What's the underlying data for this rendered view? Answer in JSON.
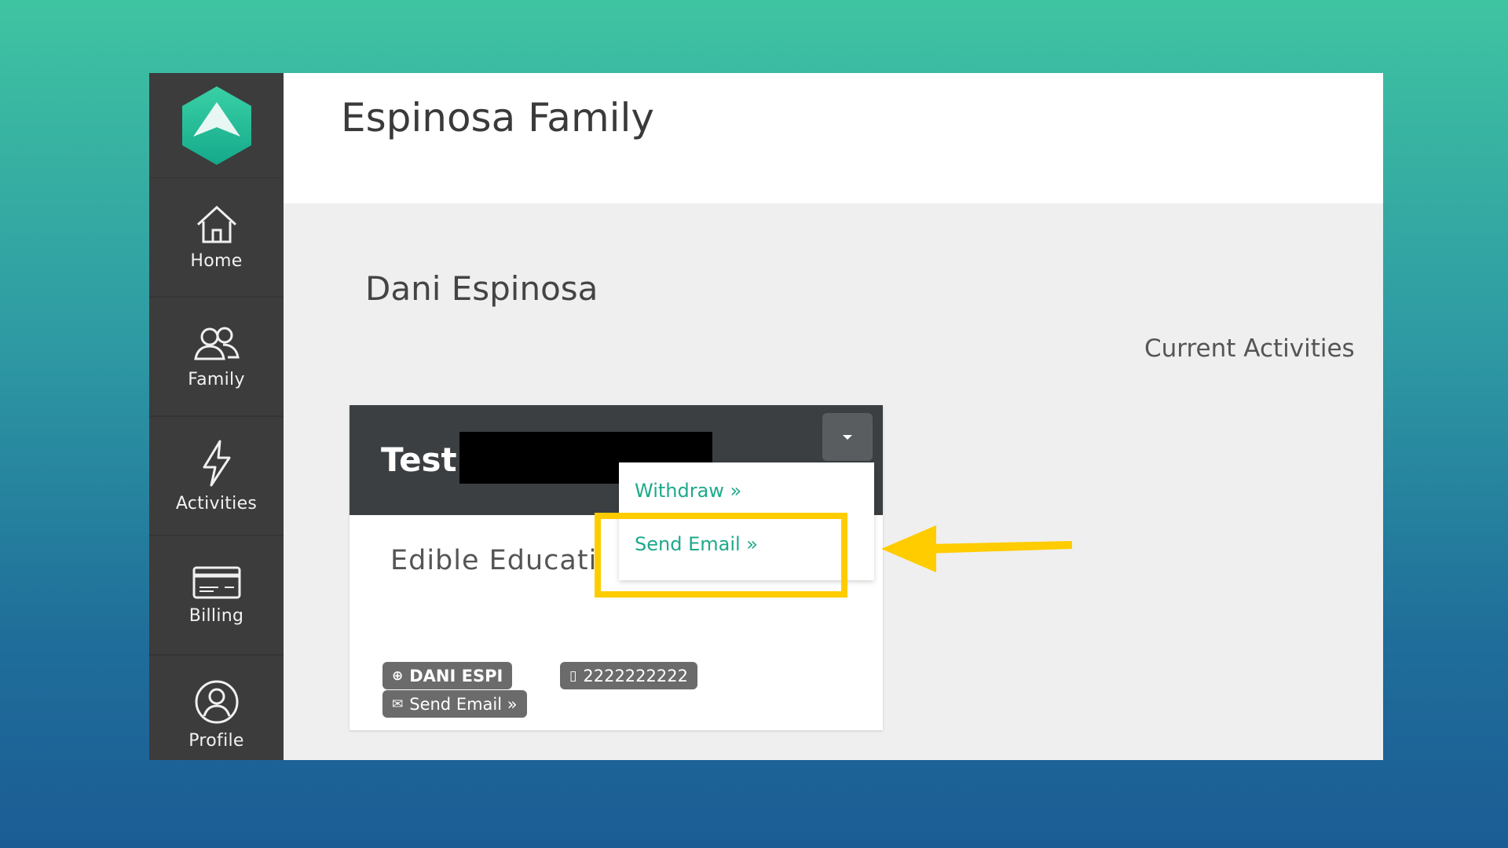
{
  "app": {
    "family_title": "Espinosa Family"
  },
  "sidebar": {
    "items": [
      {
        "label": "Home",
        "icon": "home-icon"
      },
      {
        "label": "Family",
        "icon": "family-icon"
      },
      {
        "label": "Activities",
        "icon": "lightning-icon"
      },
      {
        "label": "Billing",
        "icon": "billing-card-icon"
      },
      {
        "label": "Profile",
        "icon": "profile-icon"
      }
    ]
  },
  "main": {
    "person_name": "Dani Espinosa",
    "current_activities_label": "Current Activities"
  },
  "card": {
    "title": "Test",
    "subtitle": "Edible Educati",
    "chips": {
      "name": "DANI ESPI",
      "phone": "2222222222",
      "email": "Send Email »"
    }
  },
  "dropdown": {
    "withdraw": "Withdraw »",
    "send_email": "Send Email »"
  },
  "colors": {
    "accent_teal": "#1ea98c",
    "highlight_yellow": "#ffcc00",
    "sidebar_bg": "#3c3c3c"
  }
}
